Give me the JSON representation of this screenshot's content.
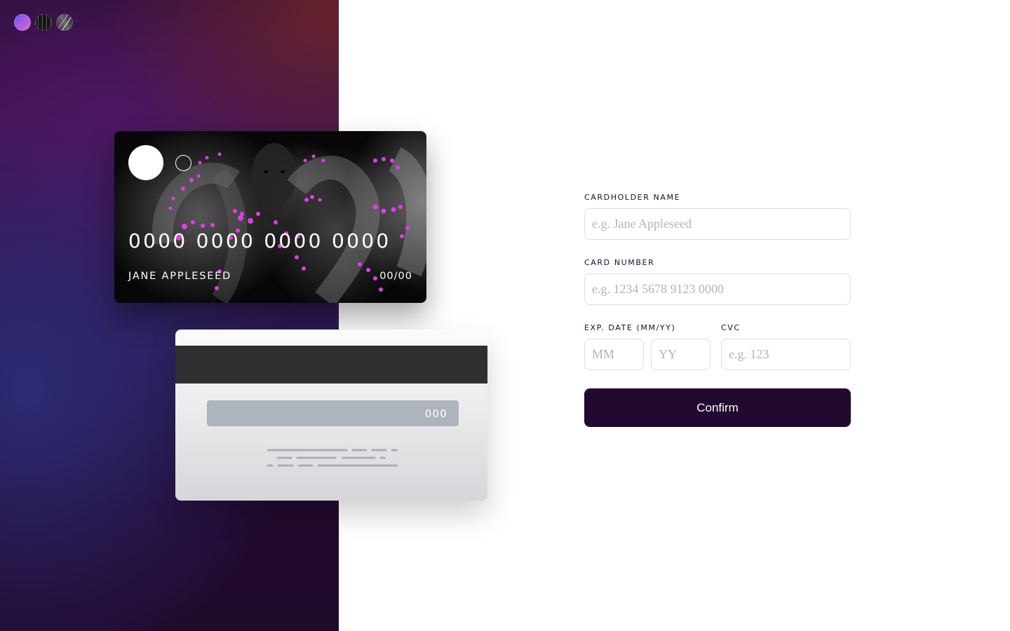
{
  "theme_switcher": {
    "options": [
      {
        "icon": "gradient-theme-icon"
      },
      {
        "icon": "snake-theme-icon"
      },
      {
        "icon": "marble-theme-icon"
      }
    ]
  },
  "card_front": {
    "number": "0000 0000 0000 0000",
    "name": "JANE APPLESEED",
    "expiry": "00/00",
    "accent_color": "#e03ce8"
  },
  "card_back": {
    "cvc": "000"
  },
  "form": {
    "cardholder_label": "CARDHOLDER NAME",
    "cardholder_placeholder": "e.g. Jane Appleseed",
    "number_label": "CARD NUMBER",
    "number_placeholder": "e.g. 1234 5678 9123 0000",
    "expiry_label": "EXP. DATE (MM/YY)",
    "month_placeholder": "MM",
    "year_placeholder": "YY",
    "cvc_label": "CVC",
    "cvc_placeholder": "e.g. 123",
    "confirm_label": "Confirm"
  },
  "colors": {
    "primary": "#21092f",
    "input_border": "#dedddf",
    "placeholder": "#b5b3b9"
  }
}
